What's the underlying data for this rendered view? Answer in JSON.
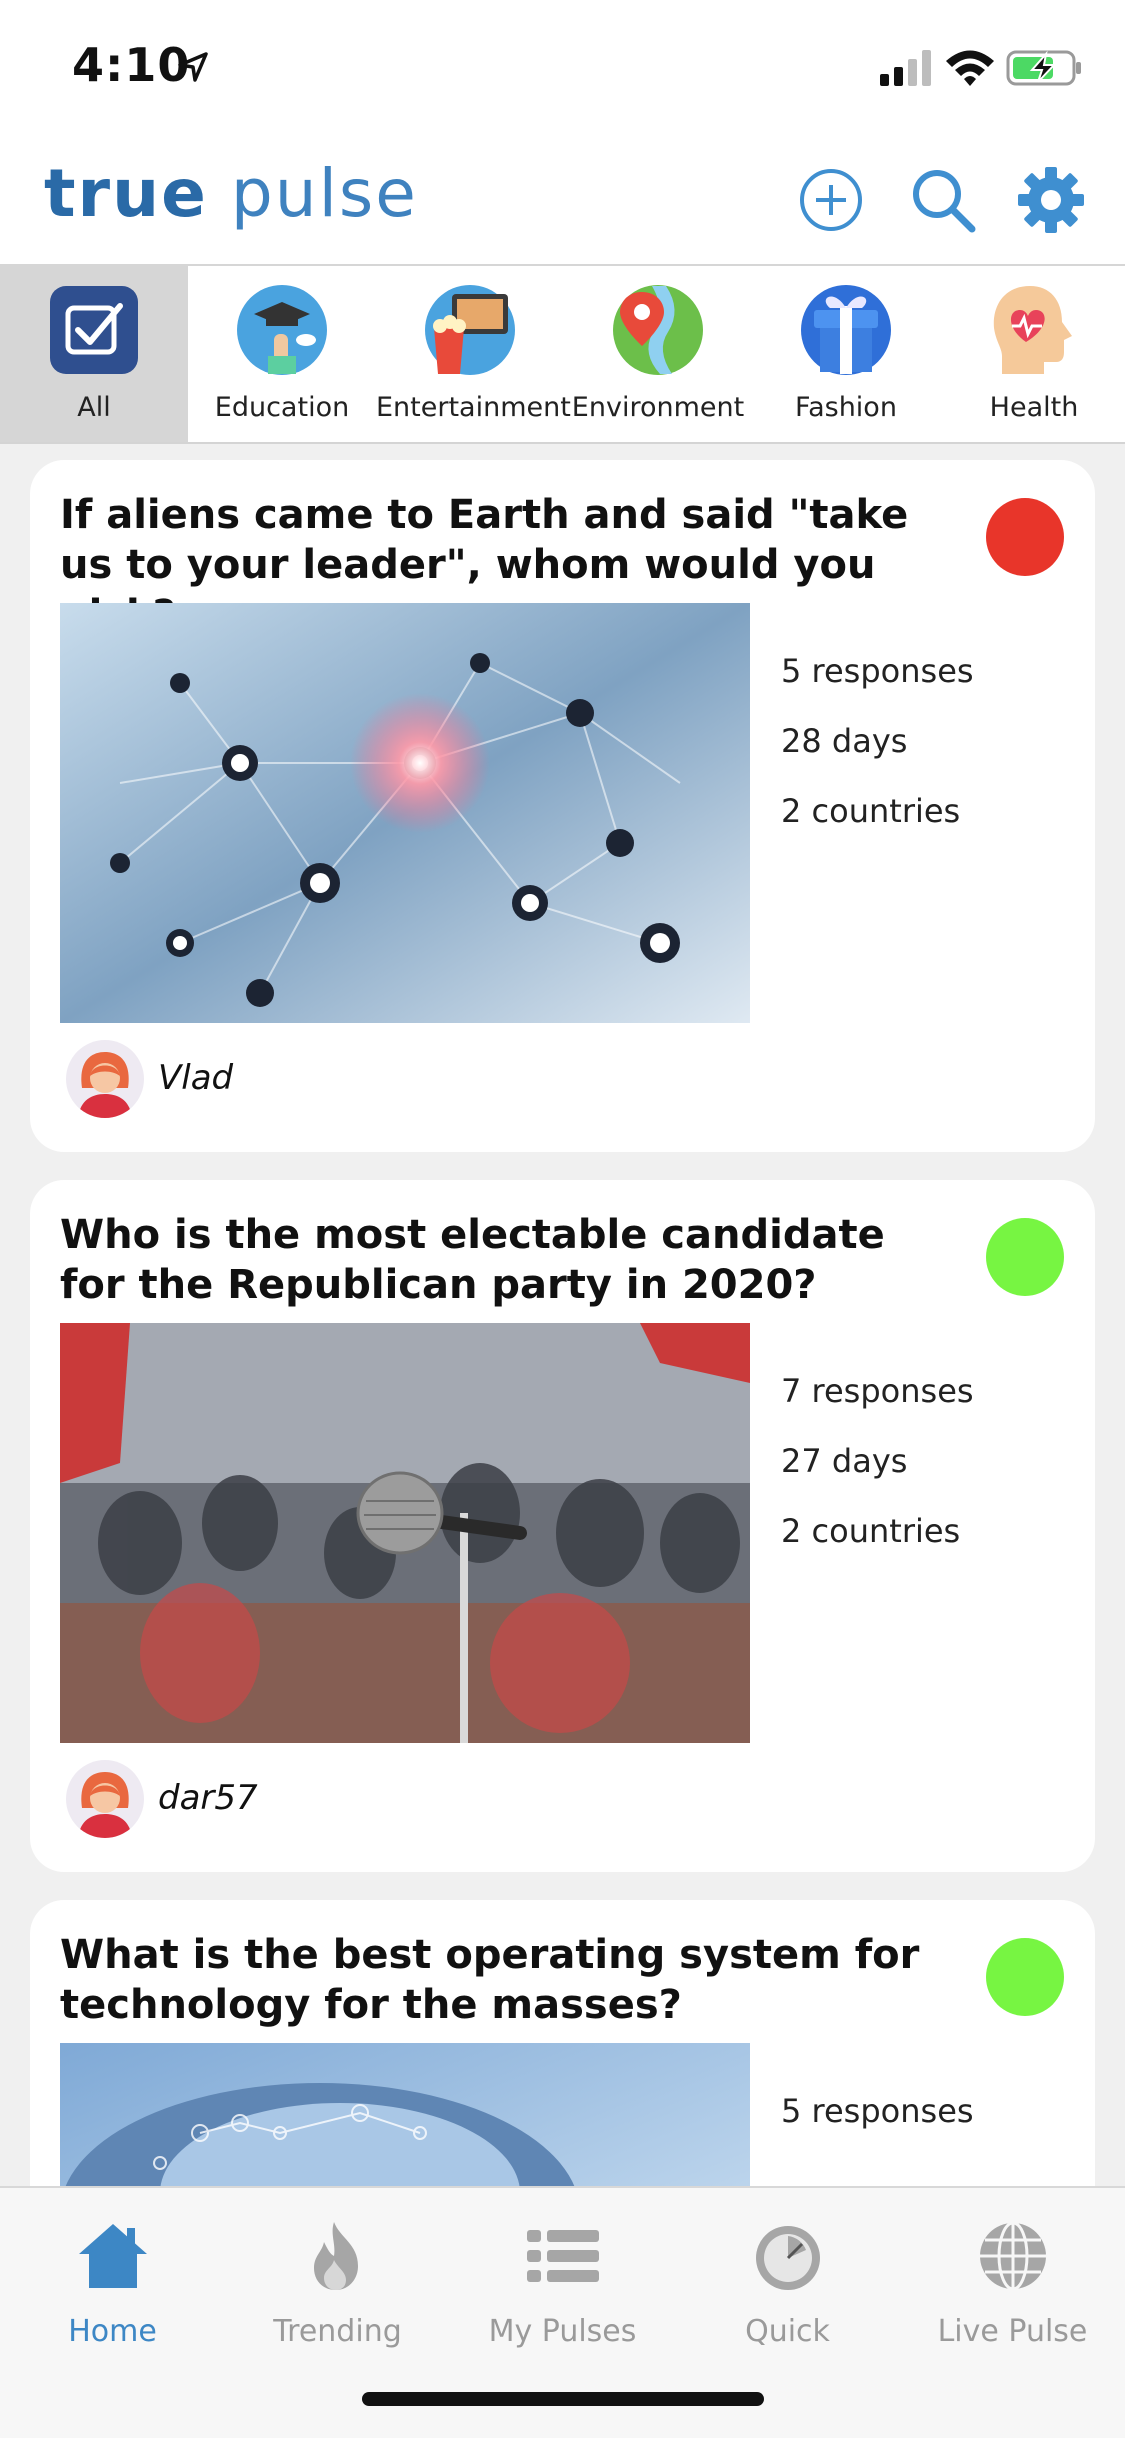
{
  "status_bar": {
    "time": "4:10",
    "icons": [
      "location-arrow-icon",
      "cellular-signal-icon",
      "wifi-icon",
      "battery-charging-icon"
    ]
  },
  "header": {
    "logo_bold": "true",
    "logo_light": "pulse",
    "brand_color": "#2a6aa7",
    "actions": [
      "add-icon",
      "search-icon",
      "gear-icon"
    ]
  },
  "categories": [
    {
      "label": "All",
      "icon": "checkbox-icon",
      "selected": true
    },
    {
      "label": "Education",
      "icon": "graduation-cap-icon",
      "selected": false
    },
    {
      "label": "Entertainment",
      "icon": "popcorn-tv-icon",
      "selected": false
    },
    {
      "label": "Environment",
      "icon": "map-pin-earth-icon",
      "selected": false
    },
    {
      "label": "Fashion",
      "icon": "gift-box-icon",
      "selected": false
    },
    {
      "label": "Health",
      "icon": "head-heart-icon",
      "selected": false
    }
  ],
  "feed": [
    {
      "question": "If aliens came to Earth and said \"take us to your leader\", whom would you pick?",
      "status_color": "#e8352a",
      "responses": "5 responses",
      "days": "28 days",
      "countries": "2 countries",
      "author": "Vlad",
      "image": "network-globe-image"
    },
    {
      "question": "Who is the most electable candidate for the Republican party in 2020?",
      "status_color": "#77f542",
      "responses": "7 responses",
      "days": "27 days",
      "countries": "2 countries",
      "author": "dar57",
      "image": "microphone-crowd-image"
    },
    {
      "question": "What is the best operating system for technology for the masses?",
      "status_color": "#77f542",
      "responses": "5 responses",
      "image": "brain-circuit-image"
    }
  ],
  "tabbar": {
    "items": [
      {
        "label": "Home",
        "icon": "home-icon",
        "active": true
      },
      {
        "label": "Trending",
        "icon": "flame-icon",
        "active": false
      },
      {
        "label": "My Pulses",
        "icon": "list-icon",
        "active": false
      },
      {
        "label": "Quick",
        "icon": "stopwatch-icon",
        "active": false
      },
      {
        "label": "Live Pulse",
        "icon": "globe-icon",
        "active": false
      }
    ],
    "active_color": "#3d87c5",
    "inactive_color": "#9a9a9a"
  }
}
